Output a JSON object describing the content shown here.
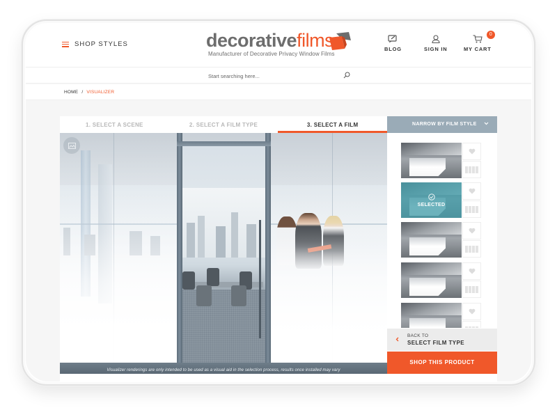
{
  "header": {
    "menu_label": "SHOP STYLES",
    "logo": {
      "word1": "decorative",
      "word2": "films",
      "tagline": "Manufacturer of Decorative Privacy Window Films"
    },
    "nav": [
      {
        "label": "BLOG",
        "icon": "blog-icon"
      },
      {
        "label": "SIGN IN",
        "icon": "user-icon"
      },
      {
        "label": "MY CART",
        "icon": "cart-icon",
        "badge": "0"
      }
    ]
  },
  "search": {
    "placeholder": "Start searching here..."
  },
  "breadcrumb": {
    "home": "HOME",
    "separator": "/",
    "current": "VISUALIZER"
  },
  "visualizer": {
    "steps": [
      {
        "label": "1. SELECT A SCENE",
        "active": false
      },
      {
        "label": "2. SELECT A FILM TYPE",
        "active": false
      },
      {
        "label": "3. SELECT A FILM",
        "active": true
      }
    ],
    "disclaimer": "Visualizer renderings are only intended to be used as a visual aid in the selection process, results once installed may vary",
    "panel": {
      "filter_label": "NARROW BY FILM STYLE",
      "films": [
        {
          "selected": false
        },
        {
          "selected": true,
          "selected_label": "SELECTED"
        },
        {
          "selected": false
        },
        {
          "selected": false
        },
        {
          "selected": false
        }
      ],
      "back": {
        "small": "BACK TO",
        "big": "SELECT FILM TYPE"
      },
      "shop_label": "SHOP THIS PRODUCT"
    }
  },
  "colors": {
    "accent": "#f0582a",
    "filter_bar": "#9aabb7",
    "selected_overlay": "#449eaa"
  }
}
